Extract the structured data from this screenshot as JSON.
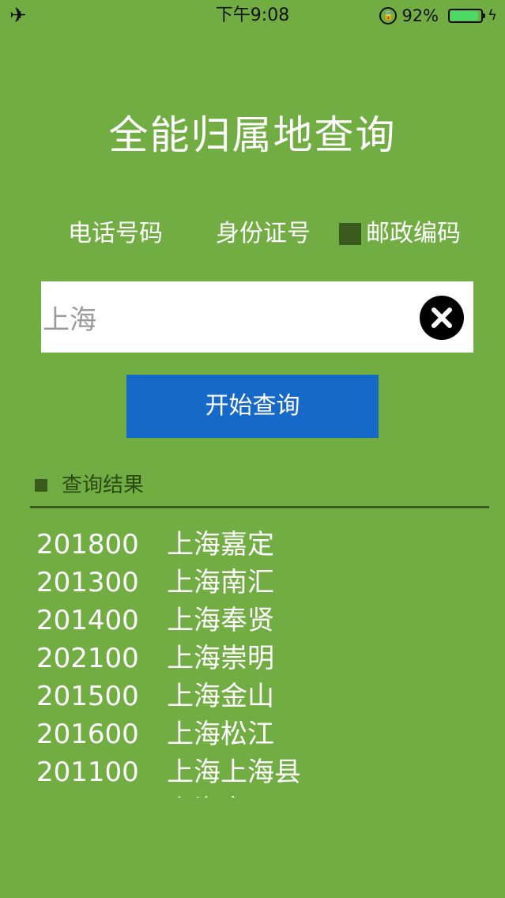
{
  "status_bar": {
    "airplane_icon": "airplane-icon",
    "time": "下午9:08",
    "battery_percent": "92%",
    "battery_level": 0.92,
    "battery_color": "#4cd964"
  },
  "app": {
    "title": "全能归属地查询"
  },
  "tabs": {
    "phone": "电话号码",
    "id_card": "身份证号",
    "postal": "邮政编码",
    "selected": "postal"
  },
  "search": {
    "value": "上海",
    "clear_icon": "clear-icon"
  },
  "query_button": {
    "label": "开始查询",
    "color": "#1668c9"
  },
  "results": {
    "title": "查询结果",
    "items": [
      {
        "code": "201800",
        "place": "上海嘉定"
      },
      {
        "code": "201300",
        "place": "上海南汇"
      },
      {
        "code": "201400",
        "place": "上海奉贤"
      },
      {
        "code": "202100",
        "place": "上海崇明"
      },
      {
        "code": "201500",
        "place": "上海金山"
      },
      {
        "code": "201600",
        "place": "上海松江"
      },
      {
        "code": "201100",
        "place": "上海上海县"
      },
      {
        "code": "",
        "place": "上海市区"
      }
    ]
  },
  "colors": {
    "background": "#71ad43",
    "marker": "#3b5a1e"
  }
}
